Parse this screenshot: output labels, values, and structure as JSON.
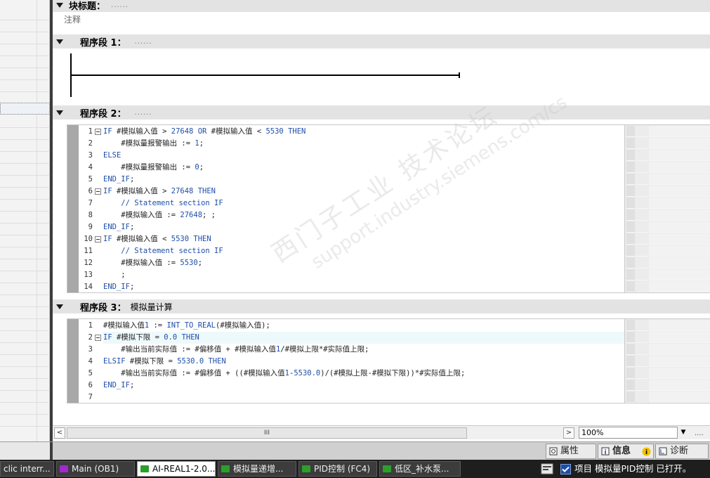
{
  "editor": {
    "block_title": {
      "label": "块标题：",
      "dots": "......",
      "comment": "注释"
    },
    "sections": [
      {
        "label": "程序段 1：",
        "dots": "......",
        "name": ""
      },
      {
        "label": "程序段 2：",
        "dots": "......",
        "name": ""
      },
      {
        "label": "程序段 3：",
        "dots": "",
        "name": "模拟量计算"
      }
    ],
    "code2": [
      {
        "n": "1",
        "t": "IF #模拟输入值 > 27648 OR #模拟输入值 < 5530 THEN"
      },
      {
        "n": "2",
        "t": "    #模拟量报警输出 := 1;"
      },
      {
        "n": "3",
        "t": "ELSE"
      },
      {
        "n": "4",
        "t": "    #模拟量报警输出 := 0;"
      },
      {
        "n": "5",
        "t": "END_IF;"
      },
      {
        "n": "6",
        "t": "IF #模拟输入值 > 27648 THEN"
      },
      {
        "n": "7",
        "t": "    // Statement section IF"
      },
      {
        "n": "8",
        "t": "    #模拟输入值 := 27648; ;"
      },
      {
        "n": "9",
        "t": "END_IF;"
      },
      {
        "n": "10",
        "t": "IF #模拟输入值 < 5530 THEN"
      },
      {
        "n": "11",
        "t": "    // Statement section IF"
      },
      {
        "n": "12",
        "t": "    #模拟输入值 := 5530;"
      },
      {
        "n": "13",
        "t": "    ;"
      },
      {
        "n": "14",
        "t": "END_IF;"
      }
    ],
    "code3": [
      {
        "n": "1",
        "t": "#模拟输入值1 := INT_TO_REAL(#模拟输入值);"
      },
      {
        "n": "2",
        "t": "IF #模拟下限 = 0.0 THEN"
      },
      {
        "n": "3",
        "t": "    #输出当前实际值 := #偏移值 + #模拟输入值1/#模拟上限*#实际值上限;"
      },
      {
        "n": "4",
        "t": "ELSIF #模拟下限 = 5530.0 THEN"
      },
      {
        "n": "5",
        "t": "    #输出当前实际值 := #偏移值 + ((#模拟输入值1-5530.0)/(#模拟上限-#模拟下限))*#实际值上限;"
      },
      {
        "n": "6",
        "t": "END_IF;"
      },
      {
        "n": "7",
        "t": ""
      }
    ]
  },
  "scrollbar": {
    "left_arrow": "<",
    "right_arrow": ">",
    "thumb_grip": "III",
    "zoom": "100%",
    "zoom_arrow": "▼",
    "extra": "...."
  },
  "inspector": {
    "properties": "属性",
    "info": "信息",
    "diagnostics": "诊断"
  },
  "taskbar": {
    "tasks": [
      {
        "label": "clic interr...",
        "color": ""
      },
      {
        "label": "Main (OB1)",
        "color": "#a02ad0"
      },
      {
        "label": "AI-REAL1-2.0...",
        "color": "#2aa02a"
      },
      {
        "label": "模拟量递增...",
        "color": "#2aa02a"
      },
      {
        "label": "PID控制 (FC4)",
        "color": "#2aa02a"
      },
      {
        "label": "低区_补水泵...",
        "color": "#2aa02a"
      }
    ],
    "status": "项目 模拟量PID控制 已打开。"
  },
  "watermark": {
    "cn": "西门子工业  技术论坛",
    "url": "support.industry.siemens.com/cs"
  },
  "colors": {
    "keyword": "#1f4ea8",
    "comment": "#1f4ea8",
    "accent": "#3c3c3c"
  }
}
